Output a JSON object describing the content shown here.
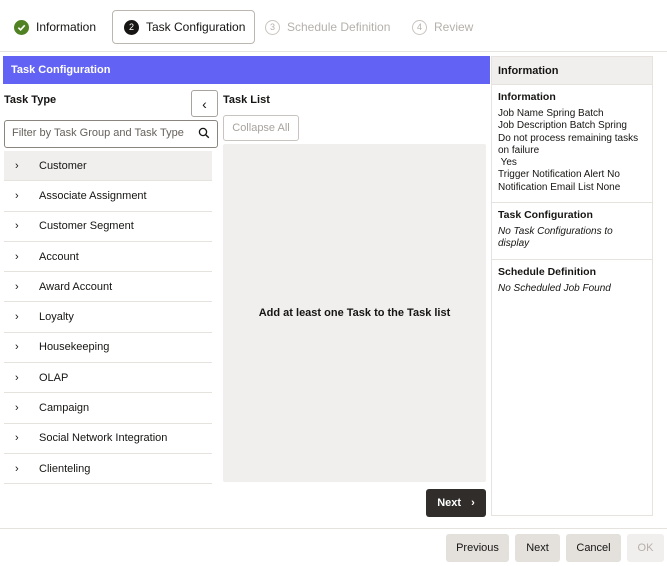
{
  "train": {
    "steps": [
      {
        "number": "1",
        "label": "Information",
        "state": "complete"
      },
      {
        "number": "2",
        "label": "Task Configuration",
        "state": "current"
      },
      {
        "number": "3",
        "label": "Schedule Definition",
        "state": "disabled"
      },
      {
        "number": "4",
        "label": "Review",
        "state": "disabled"
      }
    ]
  },
  "task_panel": {
    "header": "Task Configuration",
    "task_type_label": "Task Type",
    "filter_placeholder": "Filter by Task Group and Task Type",
    "task_list_label": "Task List",
    "collapse_all_label": "Collapse All",
    "empty_message": "Add at least one Task to the Task list",
    "next_label": "Next",
    "tree_items": [
      {
        "label": "Customer",
        "selected": true
      },
      {
        "label": "Associate Assignment"
      },
      {
        "label": "Customer Segment"
      },
      {
        "label": "Account"
      },
      {
        "label": "Award Account"
      },
      {
        "label": "Loyalty"
      },
      {
        "label": "Housekeeping"
      },
      {
        "label": "OLAP"
      },
      {
        "label": "Campaign"
      },
      {
        "label": "Social Network Integration"
      },
      {
        "label": "Clienteling"
      }
    ]
  },
  "info_panel": {
    "header": "Information",
    "information": {
      "title": "Information",
      "lines": [
        "Job Name Spring Batch",
        "Job Description Batch Spring",
        "Do not process remaining tasks on failure",
        " Yes",
        "Trigger Notification Alert No",
        "Notification Email List None"
      ]
    },
    "task_configuration": {
      "title": "Task Configuration",
      "text": "No Task Configurations to display"
    },
    "schedule_definition": {
      "title": "Schedule Definition",
      "text": "No Scheduled Job Found"
    }
  },
  "footer": {
    "previous_label": "Previous",
    "next_label": "Next",
    "cancel_label": "Cancel",
    "ok_label": "OK"
  },
  "colors": {
    "header_accent": "#6262f4",
    "complete_step": "#508223",
    "dark_button": "#312d2a"
  }
}
